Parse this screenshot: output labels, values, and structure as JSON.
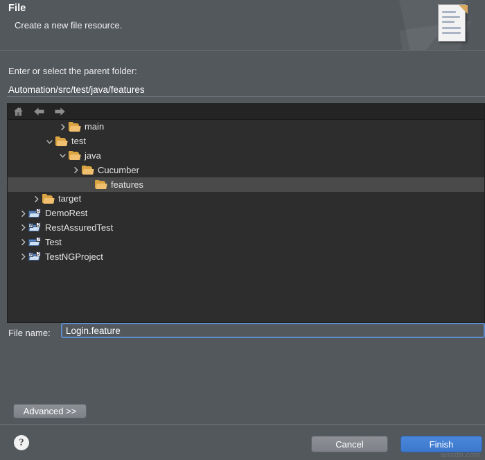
{
  "header": {
    "title": "File",
    "subtitle": "Create a new file resource.",
    "icon": "file-document-icon"
  },
  "parent_folder": {
    "label": "Enter or select the parent folder:",
    "value": "Automation/src/test/java/features",
    "placeholder": ""
  },
  "tree_toolbar": {
    "home_icon": "home-icon",
    "back_icon": "arrow-left-icon",
    "forward_icon": "arrow-right-icon"
  },
  "tree": {
    "rows": [
      {
        "label": "main",
        "indent": 3,
        "twisty": "collapsed",
        "icon": "folder-icon",
        "selected": false
      },
      {
        "label": "test",
        "indent": 2,
        "twisty": "expanded",
        "icon": "folder-icon",
        "selected": false
      },
      {
        "label": "java",
        "indent": 3,
        "twisty": "expanded",
        "icon": "folder-icon",
        "selected": false
      },
      {
        "label": "Cucumber",
        "indent": 4,
        "twisty": "collapsed",
        "icon": "folder-icon",
        "selected": false
      },
      {
        "label": "features",
        "indent": 5,
        "twisty": "none",
        "icon": "folder-icon",
        "selected": true
      },
      {
        "label": "target",
        "indent": 1,
        "twisty": "collapsed",
        "icon": "folder-icon",
        "selected": false
      },
      {
        "label": "DemoRest",
        "indent": 0,
        "twisty": "collapsed",
        "icon": "java-project-icon",
        "selected": false
      },
      {
        "label": "RestAssuredTest",
        "indent": 0,
        "twisty": "collapsed",
        "icon": "maven-project-icon",
        "selected": false
      },
      {
        "label": "Test",
        "indent": 0,
        "twisty": "collapsed",
        "icon": "java-project-icon",
        "selected": false
      },
      {
        "label": "TestNGProject",
        "indent": 0,
        "twisty": "collapsed",
        "icon": "maven-project-icon",
        "selected": false
      }
    ]
  },
  "file_name": {
    "label": "File name:",
    "value": "Login.feature",
    "placeholder": ""
  },
  "advanced": {
    "label": "Advanced >>"
  },
  "footer": {
    "help_icon": "help-question-icon",
    "help_glyph": "?",
    "cancel_label": "Cancel",
    "finish_label": "Finish"
  },
  "watermark": {
    "text": "wsxdn.com"
  },
  "colors": {
    "dialog_bg": "#53585d",
    "tree_bg": "#2d2d2d",
    "tree_toolbar_bg": "#242424",
    "selection_bg": "#4a4a4a",
    "accent_blue": "#3c78cd",
    "focus_ring": "#5b8dcf",
    "folder_amber": "#d9a441",
    "text": "#e8e8e8"
  }
}
